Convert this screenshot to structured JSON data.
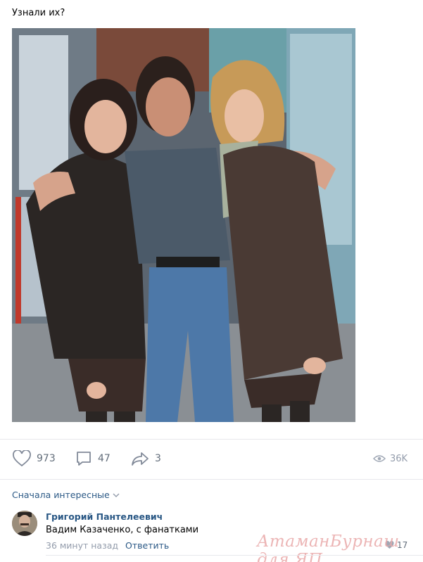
{
  "post": {
    "text": "Узнали их?",
    "image_alt": "Фото: двое женщин в кожаных куртках и мужчина между ними"
  },
  "actions": {
    "likes": "973",
    "comments": "47",
    "shares": "3",
    "views": "36K"
  },
  "comments_section": {
    "sort_label": "Сначала интересные",
    "items": [
      {
        "author": "Григорий Пантелеевич",
        "text": "Вадим Казаченко, с фанатками",
        "time": "36 минут назад",
        "reply_label": "Ответить",
        "likes": "17"
      }
    ]
  },
  "watermark": "АтаманБурнаш для ЯП",
  "colors": {
    "link": "#2a5885",
    "muted": "#939cab",
    "icon": "#626d7a",
    "divider": "#e7e8ec"
  }
}
